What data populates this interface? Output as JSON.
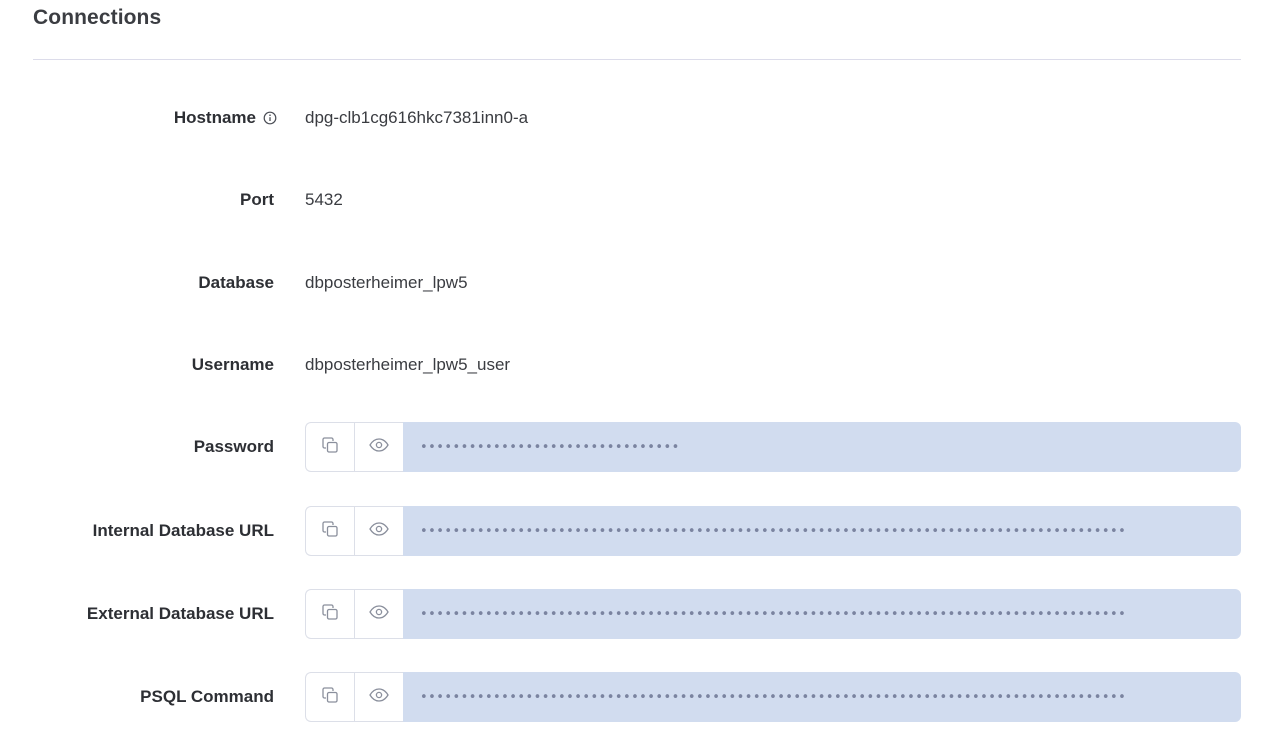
{
  "section": {
    "title": "Connections"
  },
  "fields": {
    "hostname": {
      "label": "Hostname",
      "value": "dpg-clb1cg616hkc7381inn0-a"
    },
    "port": {
      "label": "Port",
      "value": "5432"
    },
    "database": {
      "label": "Database",
      "value": "dbposterheimer_lpw5"
    },
    "username": {
      "label": "Username",
      "value": "dbposterheimer_lpw5_user"
    },
    "password": {
      "label": "Password",
      "masked": "••••••••••••••••••••••••••••••••"
    },
    "internal_url": {
      "label": "Internal Database URL",
      "masked": "•••••••••••••••••••••••••••••••••••••••••••••••••••••••••••••••••••••••••••••••••••••••"
    },
    "external_url": {
      "label": "External Database URL",
      "masked": "•••••••••••••••••••••••••••••••••••••••••••••••••••••••••••••••••••••••••••••••••••••••"
    },
    "psql_command": {
      "label": "PSQL Command",
      "masked": "•••••••••••••••••••••••••••••••••••••••••••••••••••••••••••••••••••••••••••••••••••••••"
    }
  },
  "icons": {
    "info": "info-icon",
    "copy": "copy-icon",
    "reveal": "eye-icon"
  },
  "colors": {
    "secret_field_bg": "#d1dcef",
    "dots": "#7b84a0",
    "divider": "#dcdcea"
  }
}
